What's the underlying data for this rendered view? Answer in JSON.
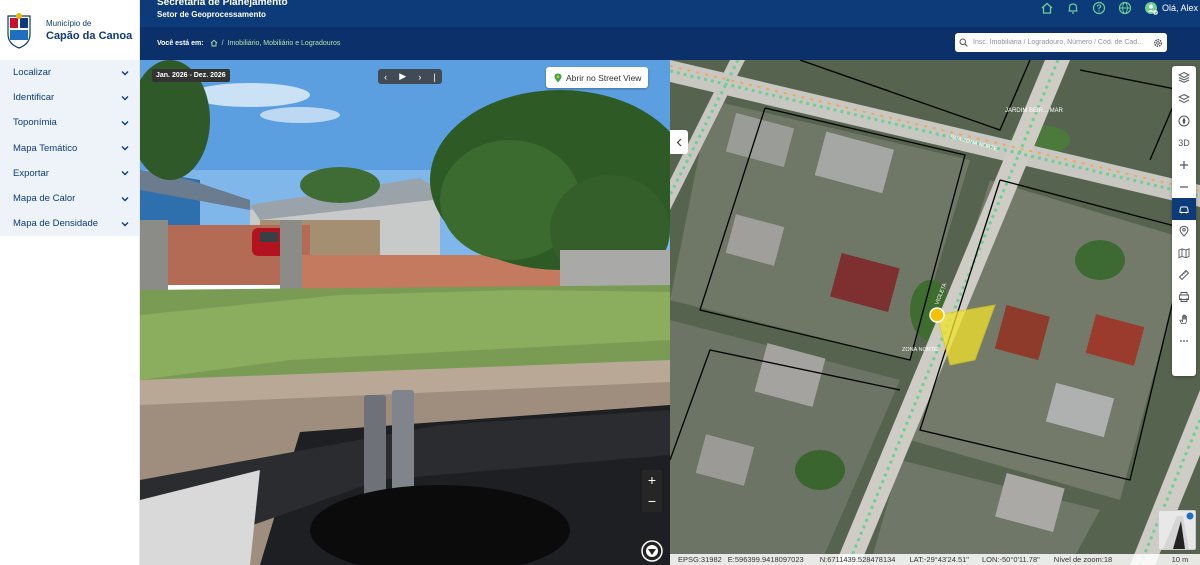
{
  "municipality": {
    "label": "Município de",
    "name": "Capão da Canoa",
    "seal_text": "CAPÃO DA CANOA"
  },
  "sidebar": {
    "items": [
      {
        "label": "Localizar"
      },
      {
        "label": "Identificar"
      },
      {
        "label": "Toponímia"
      },
      {
        "label": "Mapa Temático"
      },
      {
        "label": "Exportar"
      },
      {
        "label": "Mapa de Calor"
      },
      {
        "label": "Mapa de Densidade"
      }
    ]
  },
  "header": {
    "title": "Secretaria de Planejamento",
    "subtitle": "Setor de Geoprocessamento",
    "greeting": "Olá, Alex",
    "icons": [
      "home-icon",
      "bell-icon",
      "help-icon",
      "globe-icon",
      "user-icon"
    ]
  },
  "breadcrumb": {
    "prefix": "Você está em:",
    "page": "Imobiliário, Mobiliário e Logradouros"
  },
  "search": {
    "placeholder": "Insc. Imobiliária / Logradouro, Número / Cód. de Cad..."
  },
  "streetview": {
    "date_range": "Jan. 2026 - Dez. 2026",
    "open_button": "Abrir no Street View",
    "zoom_in": "+",
    "zoom_out": "−"
  },
  "map": {
    "toolbar": [
      "layers-icon",
      "layers-alt-icon",
      "compass-icon",
      "3D",
      "zoom-in-icon",
      "zoom-out-icon",
      "car-icon",
      "location-icon",
      "map-icon",
      "ruler-icon",
      "print-icon",
      "hand-icon",
      "more-icon"
    ],
    "toolbar_3d": "3D",
    "street_labels": [
      "JARDIM BEIR... MAR",
      "RUA ZONA NORTE",
      "ZONA NORTE",
      "VIOLETA"
    ],
    "status": {
      "epsg": "EPSG:31982",
      "easting": "E:596399.9418097023",
      "northing": "N:6711439.528478134",
      "lat": "LAT:-29°43'24.51\"",
      "lon": "LON:-50°0'11.78\"",
      "zoom": "Nível de zoom:18"
    },
    "scale": "10 m"
  },
  "colors": {
    "brand": "#0d3a78",
    "accent": "#4caf50",
    "sidebar_bg": "#eef3f9"
  }
}
